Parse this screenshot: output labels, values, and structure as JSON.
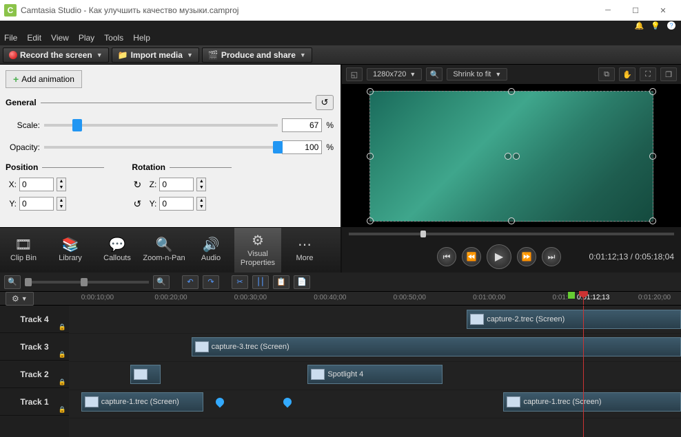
{
  "window": {
    "title": "Camtasia Studio - Как улучшить качество музыки.camproj"
  },
  "topicons": {
    "bell": "🔔",
    "bulb": "💡",
    "help": "?"
  },
  "menu": [
    "File",
    "Edit",
    "View",
    "Play",
    "Tools",
    "Help"
  ],
  "actions": {
    "record": "Record the screen",
    "import": "Import media",
    "produce": "Produce and share"
  },
  "properties": {
    "add_anim": "Add animation",
    "general": "General",
    "scale_label": "Scale:",
    "scale_value": "67",
    "opacity_label": "Opacity:",
    "opacity_value": "100",
    "pct": "%",
    "position": "Position",
    "rotation": "Rotation",
    "x_label": "X:",
    "y_label": "Y:",
    "z_label": "Z:",
    "x_value": "0",
    "y_value": "0",
    "rz_value": "0",
    "ry_value": "0"
  },
  "tooltabs": [
    {
      "label": "Clip Bin",
      "icon": "🎞"
    },
    {
      "label": "Library",
      "icon": "📚"
    },
    {
      "label": "Callouts",
      "icon": "💬"
    },
    {
      "label": "Zoom-n-Pan",
      "icon": "🔍"
    },
    {
      "label": "Audio",
      "icon": "🔊"
    },
    {
      "label": "Visual Properties",
      "icon": "⚙"
    },
    {
      "label": "More",
      "icon": "⋯"
    }
  ],
  "preview": {
    "dimensions": "1280x720",
    "zoom": "Shrink to fit",
    "time": "0:01:12;13 / 0:05:18;04"
  },
  "timeline": {
    "ticks": [
      "0:00:10;00",
      "0:00:20;00",
      "0:00:30;00",
      "0:00:40;00",
      "0:00:50;00",
      "0:01:00;00",
      "0:01:",
      "0:01:12;13",
      "0:01:20;00"
    ],
    "tracks": [
      "Track 4",
      "Track 3",
      "Track 2",
      "Track 1"
    ],
    "clips": {
      "t4": {
        "label": "capture-2.trec (Screen)"
      },
      "t3": {
        "label": "capture-3.trec (Screen)"
      },
      "t2": {
        "label": "Spotlight 4"
      },
      "t1a": {
        "label": "capture-1.trec (Screen)"
      },
      "t1b": {
        "label": "capture-1.trec (Screen)"
      }
    }
  }
}
